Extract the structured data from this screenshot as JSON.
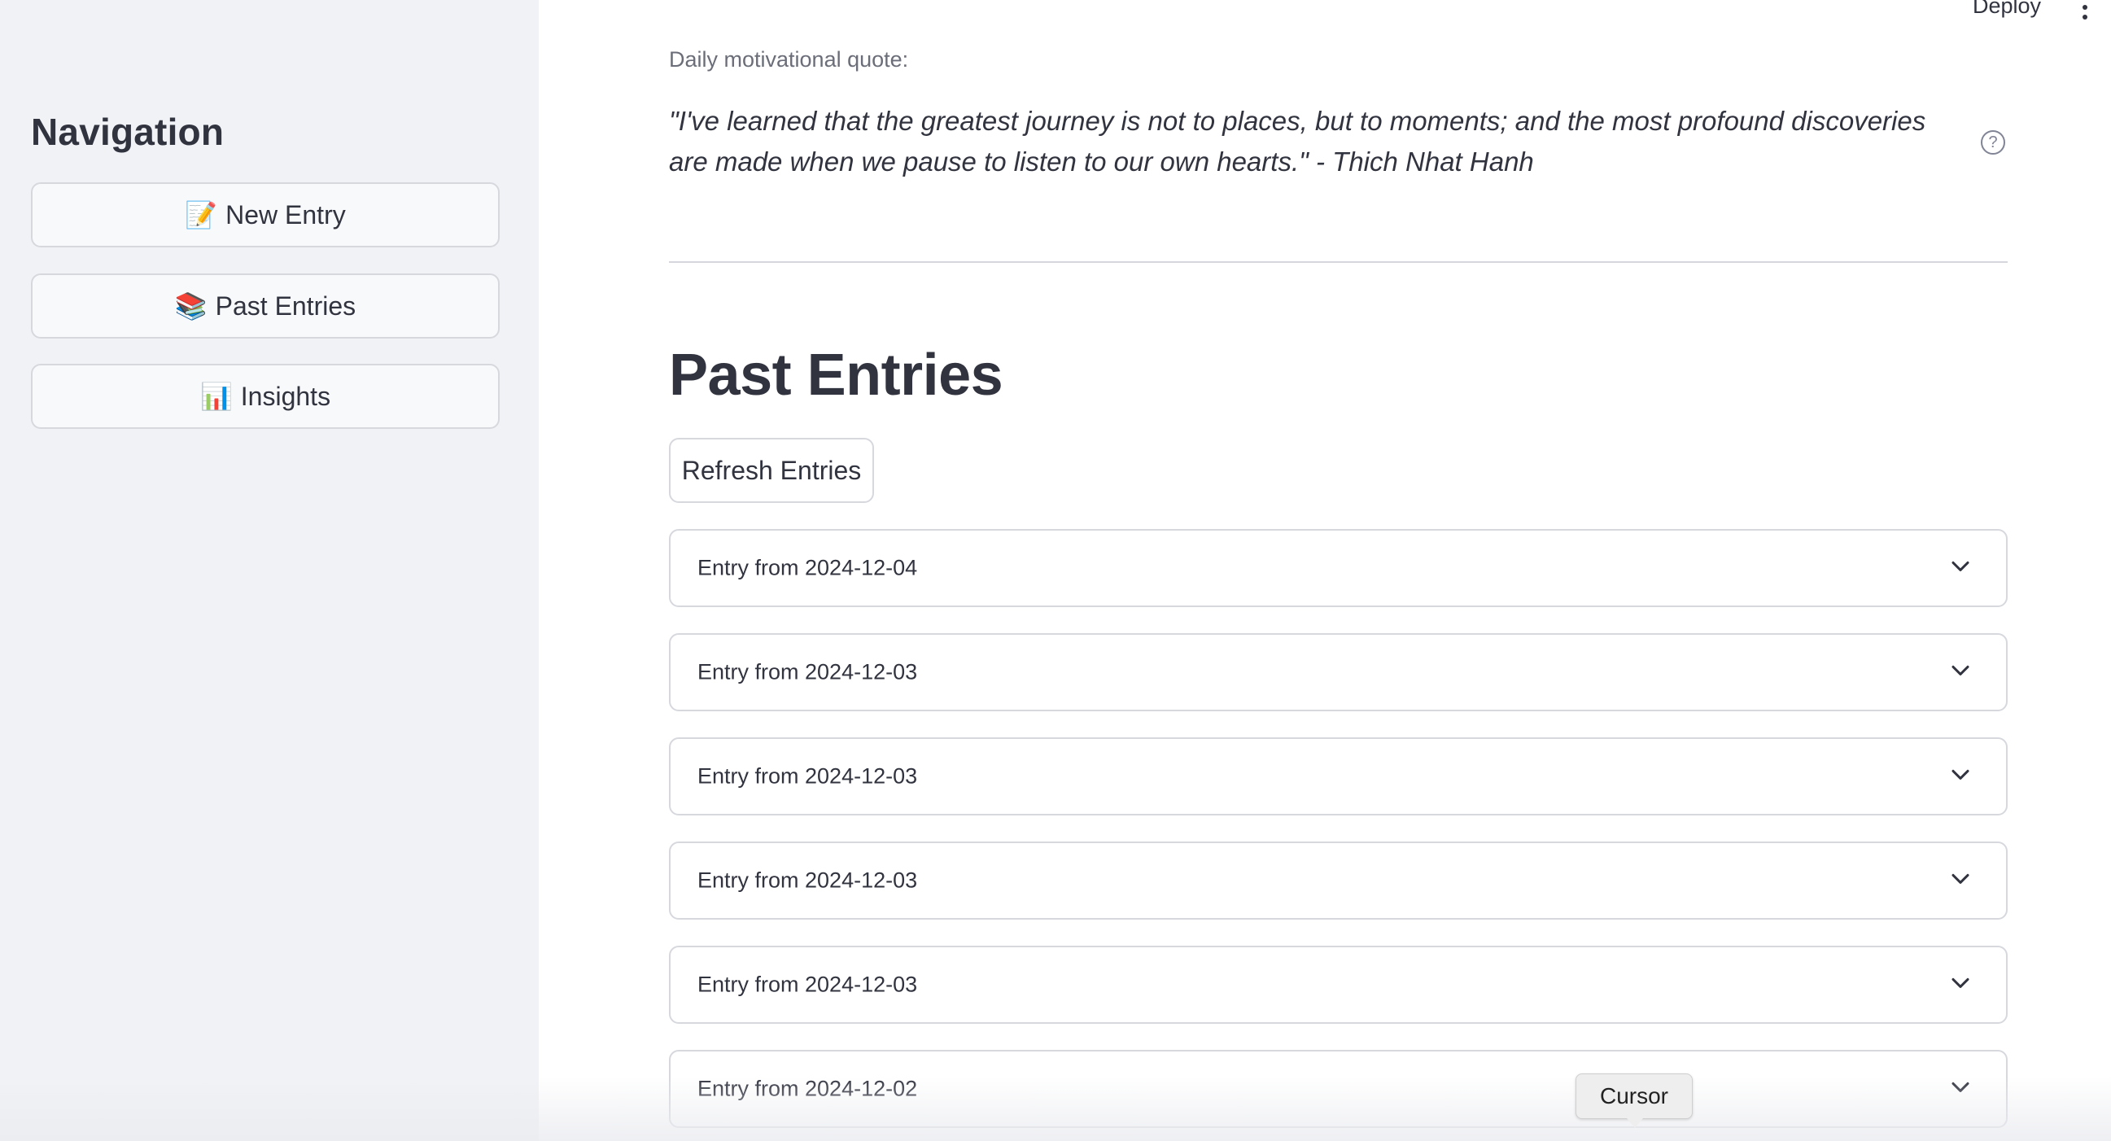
{
  "header": {
    "deploy_label": "Deploy"
  },
  "sidebar": {
    "title": "Navigation",
    "items": [
      {
        "icon": "📝",
        "icon_name": "memo-icon",
        "label": "New Entry"
      },
      {
        "icon": "📚",
        "icon_name": "books-icon",
        "label": "Past Entries"
      },
      {
        "icon": "📊",
        "icon_name": "bar-chart-icon",
        "label": "Insights"
      }
    ]
  },
  "main": {
    "quote_label": "Daily motivational quote:",
    "quote_text": "\"I've learned that the greatest journey is not to places, but to moments; and the most profound discoveries are made when we pause to listen to our own hearts.\" - Thich Nhat Hanh",
    "help_symbol": "?",
    "page_title": "Past Entries",
    "refresh_label": "Refresh Entries",
    "entries": [
      {
        "label": "Entry from 2024-12-04"
      },
      {
        "label": "Entry from 2024-12-03"
      },
      {
        "label": "Entry from 2024-12-03"
      },
      {
        "label": "Entry from 2024-12-03"
      },
      {
        "label": "Entry from 2024-12-03"
      },
      {
        "label": "Entry from 2024-12-02"
      }
    ]
  },
  "overlay": {
    "cursor_label": "Cursor"
  },
  "colors": {
    "sidebar_bg": "#f0f2f6",
    "text": "#31333f",
    "border": "#d6d8de",
    "muted": "#6b6e78"
  }
}
